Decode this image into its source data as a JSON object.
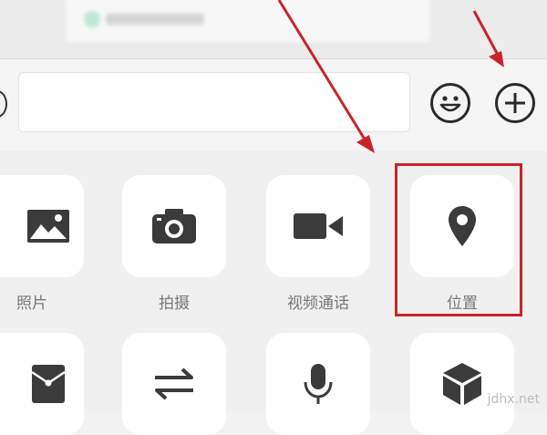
{
  "panel": {
    "items": [
      {
        "label": "照片",
        "icon": "photo-icon"
      },
      {
        "label": "拍摄",
        "icon": "camera-icon"
      },
      {
        "label": "视频通话",
        "icon": "video-call-icon"
      },
      {
        "label": "位置",
        "icon": "location-pin-icon"
      },
      {
        "icon": "red-packet-icon"
      },
      {
        "icon": "transfer-icon"
      },
      {
        "icon": "microphone-icon"
      },
      {
        "icon": "box-icon"
      }
    ]
  },
  "input_bar": {
    "buttons": [
      "emoji-icon",
      "plus-icon"
    ]
  },
  "annotation": {
    "arrow_color": "#c8252a",
    "highlight_color": "#c8252a"
  },
  "watermark": "jdhx.net"
}
